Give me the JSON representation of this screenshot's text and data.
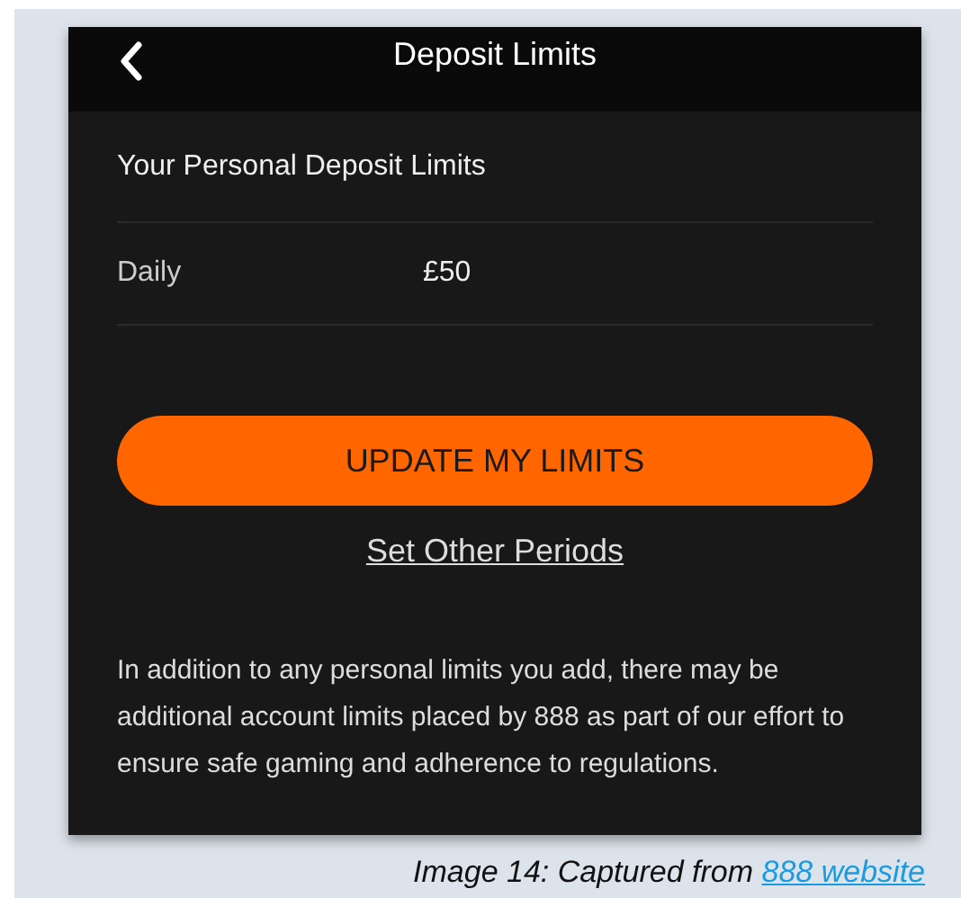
{
  "header": {
    "title": "Deposit Limits"
  },
  "section_title": "Your Personal Deposit Limits",
  "limits": [
    {
      "period": "Daily",
      "amount": "£50"
    }
  ],
  "primary_button": "UPDATE MY LIMITS",
  "secondary_link": "Set Other Periods",
  "note": "In addition to any personal limits you add, there may be additional account limits placed by 888 as part of our effort to ensure safe gaming and adherence to regulations.",
  "caption": {
    "text": "Image 14: Captured from",
    "link": "888 website"
  }
}
